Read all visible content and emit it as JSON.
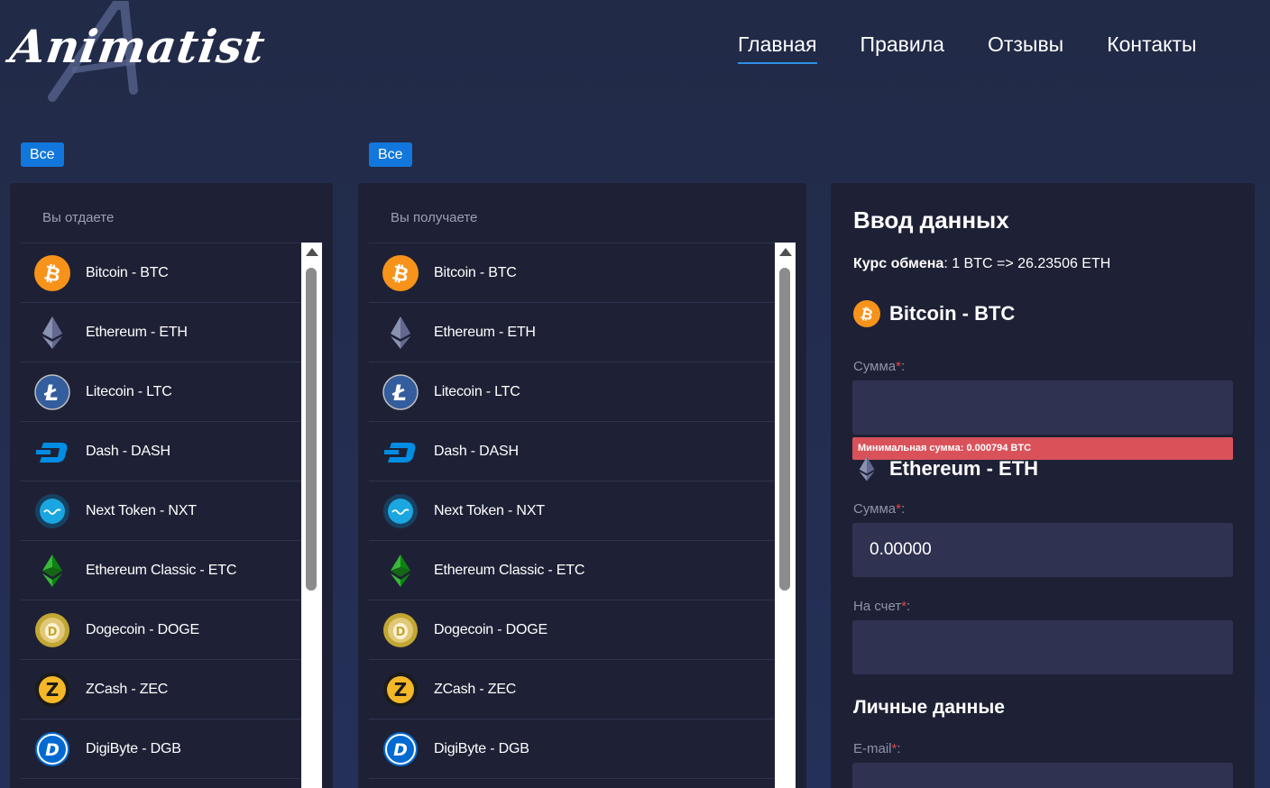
{
  "header": {
    "logo_text": "Animatist",
    "nav": [
      {
        "label": "Главная",
        "active": true
      },
      {
        "label": "Правила",
        "active": false
      },
      {
        "label": "Отзывы",
        "active": false
      },
      {
        "label": "Контакты",
        "active": false
      }
    ]
  },
  "filters": {
    "give_filter": "Все",
    "get_filter": "Все"
  },
  "give_panel": {
    "title": "Вы отдаете",
    "items": [
      {
        "label": "Bitcoin - BTC",
        "icon": "bitcoin-icon"
      },
      {
        "label": "Ethereum - ETH",
        "icon": "ethereum-icon"
      },
      {
        "label": "Litecoin - LTC",
        "icon": "litecoin-icon"
      },
      {
        "label": "Dash - DASH",
        "icon": "dash-icon"
      },
      {
        "label": "Next Token - NXT",
        "icon": "nxt-icon"
      },
      {
        "label": "Ethereum Classic - ETC",
        "icon": "ethereum-classic-icon"
      },
      {
        "label": "Dogecoin - DOGE",
        "icon": "dogecoin-icon"
      },
      {
        "label": "ZCash - ZEC",
        "icon": "zcash-icon"
      },
      {
        "label": "DigiByte - DGB",
        "icon": "digibyte-icon"
      }
    ]
  },
  "get_panel": {
    "title": "Вы получаете",
    "items": [
      {
        "label": "Bitcoin - BTC",
        "icon": "bitcoin-icon"
      },
      {
        "label": "Ethereum - ETH",
        "icon": "ethereum-icon"
      },
      {
        "label": "Litecoin - LTC",
        "icon": "litecoin-icon"
      },
      {
        "label": "Dash - DASH",
        "icon": "dash-icon"
      },
      {
        "label": "Next Token - NXT",
        "icon": "nxt-icon"
      },
      {
        "label": "Ethereum Classic - ETC",
        "icon": "ethereum-classic-icon"
      },
      {
        "label": "Dogecoin - DOGE",
        "icon": "dogecoin-icon"
      },
      {
        "label": "ZCash - ZEC",
        "icon": "zcash-icon"
      },
      {
        "label": "DigiByte - DGB",
        "icon": "digibyte-icon"
      }
    ]
  },
  "form": {
    "title": "Ввод данных",
    "rate_label": "Курс обмена",
    "rate_value": ": 1 BTC => 26.23506 ETH",
    "give_coin": "Bitcoin - BTC",
    "get_coin": "Ethereum - ETH",
    "amount_label": "Сумма",
    "amount_give_value": "",
    "min_amount_error": "Минимальная сумма: 0.000794 BTC",
    "amount_get_value": "0.00000",
    "account_label": "На счет",
    "account_value": "",
    "personal_title": "Личные данные",
    "email_label": "E-mail",
    "required_mark": "*",
    "label_suffix": ":"
  },
  "colors": {
    "accent": "#1277dc",
    "panel_bg": "#1e2135",
    "field_bg": "#2f3250",
    "error": "#d9525a"
  }
}
